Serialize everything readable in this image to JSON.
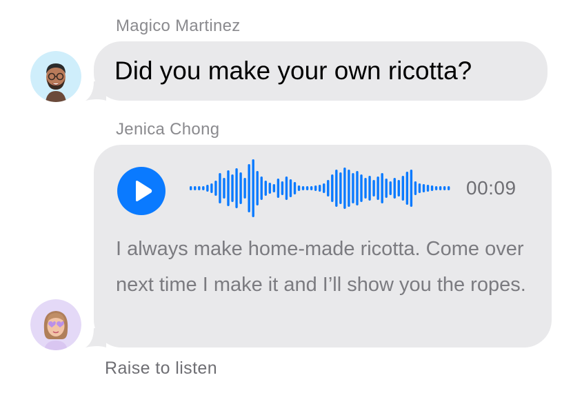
{
  "messages": [
    {
      "sender": "Magico Martinez",
      "avatar": "memoji-man-glasses-beard",
      "type": "text",
      "text": "Did you make your own ricotta?"
    },
    {
      "sender": "Jenica Chong",
      "avatar": "memoji-woman-heart-glasses",
      "type": "audio",
      "duration": "00:09",
      "transcript": "I always make home-made ricotta. Come over next time I make it and I’ll show you the ropes.",
      "play_icon": "play-icon"
    }
  ],
  "footer": {
    "hint": "Raise to listen"
  },
  "colors": {
    "accent": "#0a7aff",
    "bubble": "#e9e9eb",
    "secondary_text": "#8a8a8e",
    "avatar_1_bg": "#cfeefb",
    "avatar_2_bg": "#e4d9f7"
  }
}
